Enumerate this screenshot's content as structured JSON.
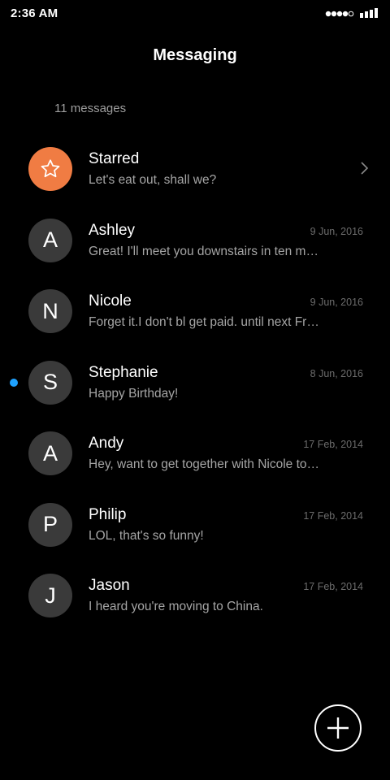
{
  "status_bar": {
    "time": "2:36 AM"
  },
  "header": {
    "title": "Messaging"
  },
  "summary": {
    "count_text": "11 messages"
  },
  "conversations": [
    {
      "avatar": "",
      "icon": "star-icon",
      "name": "Starred",
      "preview": "Let's eat out, shall we?",
      "date": "",
      "unread": false,
      "has_chevron": true
    },
    {
      "avatar": "A",
      "name": "Ashley",
      "preview": "Great! I'll meet you downstairs in ten minutes",
      "date": "9 Jun, 2016",
      "unread": false
    },
    {
      "avatar": "N",
      "name": "Nicole",
      "preview": "Forget it.I don't bl get paid. until next Friday",
      "date": "9 Jun, 2016",
      "unread": false
    },
    {
      "avatar": "S",
      "name": "Stephanie",
      "preview": "Happy Birthday!",
      "date": "8 Jun, 2016",
      "unread": true
    },
    {
      "avatar": "A",
      "name": "Andy",
      "preview": "Hey, want to get together with Nicole tonight?",
      "date": "17 Feb, 2014",
      "unread": false
    },
    {
      "avatar": "P",
      "name": "Philip",
      "preview": "LOL, that's so funny!",
      "date": "17 Feb, 2014",
      "unread": false
    },
    {
      "avatar": "J",
      "name": "Jason",
      "preview": "I heard you're moving to China.",
      "date": "17 Feb, 2014",
      "unread": false
    }
  ],
  "fab": {
    "icon": "plus-icon"
  },
  "colors": {
    "background": "#000000",
    "starred_avatar": "#f07c43",
    "avatar": "#3a3a3a",
    "unread_dot": "#1fa2ff",
    "preview_text": "#a5a5a5",
    "date_text": "#6c6c6c"
  }
}
